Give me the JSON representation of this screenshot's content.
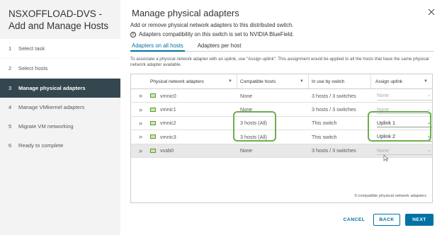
{
  "wizard": {
    "title": "NSXOFFLOAD-DVS - Add and Manage Hosts",
    "steps": [
      {
        "num": "1",
        "label": "Select task"
      },
      {
        "num": "2",
        "label": "Select hosts"
      },
      {
        "num": "3",
        "label": "Manage physical adapters"
      },
      {
        "num": "4",
        "label": "Manage VMkernel adapters"
      },
      {
        "num": "5",
        "label": "Migrate VM networking"
      },
      {
        "num": "6",
        "label": "Ready to complete"
      }
    ],
    "active_step": 3
  },
  "page": {
    "title": "Manage physical adapters",
    "subtitle": "Add or remove physical network adapters to this distributed switch.",
    "compat_info": "Adapters compatibility on this switch is set to NVIDIA BlueField.",
    "tabs": [
      "Adapters on all hosts",
      "Adapters per host"
    ],
    "active_tab": 0,
    "instructions": "To associate a physical network adapter with an uplink, use \"Assign uplink\". This assignment would be applied to all the hosts that have the same physical network adapter available."
  },
  "grid": {
    "columns": [
      "Physical network adapters",
      "Compatible hosts",
      "In use by switch",
      "Assign uplink"
    ],
    "rows": [
      {
        "adapter": "vmnic0",
        "compatible": "None",
        "in_use": "3 hosts / 3 switches",
        "uplink": "None"
      },
      {
        "adapter": "vmnic1",
        "compatible": "None",
        "in_use": "3 hosts / 3 switches",
        "uplink": "None"
      },
      {
        "adapter": "vmnic2",
        "compatible": "3 hosts (All)",
        "in_use": "This switch",
        "uplink": "Uplink 1"
      },
      {
        "adapter": "vmnic3",
        "compatible": "3 hosts (All)",
        "in_use": "This switch",
        "uplink": "Uplink 2"
      },
      {
        "adapter": "vusb0",
        "compatible": "None",
        "in_use": "3 hosts / 3 switches",
        "uplink": "None"
      }
    ],
    "footer": "0 compatible physical network adapters"
  },
  "buttons": {
    "cancel": "CANCEL",
    "back": "BACK",
    "next": "NEXT"
  },
  "colors": {
    "accent": "#0072a3",
    "active_step_bg": "#34474f",
    "highlight": "#6ab04c"
  }
}
